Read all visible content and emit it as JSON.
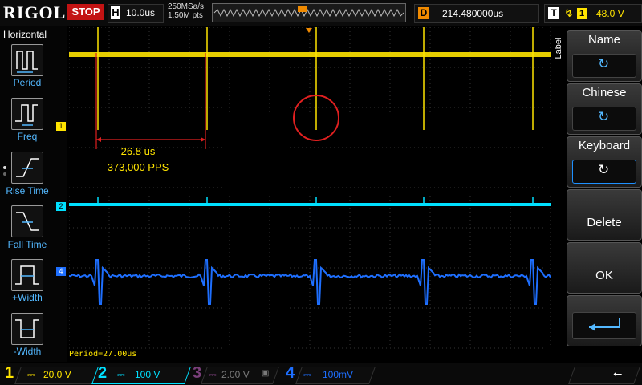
{
  "header": {
    "brand": "RIGOL",
    "run_state": "STOP",
    "timebase_label": "H",
    "timebase_value": "10.0us",
    "sample_rate": "250MSa/s",
    "memory_depth": "1.50M pts",
    "delay_label": "D",
    "delay_value": "214.480000us",
    "trigger_label": "T",
    "trigger_source": "1",
    "trigger_level": "48.0 V"
  },
  "left_menu": {
    "title": "Horizontal",
    "items": [
      {
        "label": "Period",
        "icon": "period-icon"
      },
      {
        "label": "Freq",
        "icon": "frequency-icon"
      },
      {
        "label": "Rise Time",
        "icon": "rise-time-icon"
      },
      {
        "label": "Fall Time",
        "icon": "fall-time-icon"
      },
      {
        "label": "+Width",
        "icon": "positive-width-icon"
      },
      {
        "label": "-Width",
        "icon": "negative-width-icon"
      }
    ]
  },
  "right_menu": {
    "tab_label": "Label",
    "items": [
      {
        "label": "Name"
      },
      {
        "label": "Chinese"
      },
      {
        "label": "Keyboard"
      },
      {
        "label": "Delete"
      },
      {
        "label": "OK"
      }
    ]
  },
  "annotation": {
    "interval": "26.8 us",
    "rate": "373,000 PPS"
  },
  "measurement_status": "Period=27.00us",
  "channels": [
    {
      "num": "1",
      "scale": "20.0 V",
      "color": "#ffe400"
    },
    {
      "num": "2",
      "scale": "100 V",
      "color": "#00e0ff"
    },
    {
      "num": "3",
      "scale": "2.00 V",
      "color": "#7a3f7a"
    },
    {
      "num": "4",
      "scale": "100mV",
      "color": "#1e6fff"
    }
  ],
  "colors": {
    "ch1": "#ffe400",
    "ch2": "#00e0ff",
    "ch4": "#1e6fff",
    "accent_blue": "#53b8ff",
    "stop_red": "#c31313",
    "trigger_orange": "#f08a00"
  }
}
